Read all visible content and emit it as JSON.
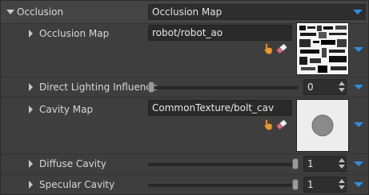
{
  "colors": {
    "accent": "#2f8fe0",
    "hand": "#e49a3a",
    "panel": "#3e3e3e"
  },
  "occlusion": {
    "label": "Occlusion",
    "mode_value": "Occlusion Map",
    "expand_icon": "triangle-down-icon"
  },
  "rows": {
    "occlusion_map": {
      "label": "Occlusion Map",
      "path": "robot/robot_ao",
      "pick_icon": "hand-pointer-icon",
      "clear_icon": "eraser-icon",
      "thumbnail": "robot-ao-texture-preview"
    },
    "direct_lighting": {
      "label": "Direct Lighting Influence",
      "value": "0",
      "slider_fraction": 0
    },
    "cavity_map": {
      "label": "Cavity Map",
      "path": "CommonTexture/bolt_cav",
      "pick_icon": "hand-pointer-icon",
      "clear_icon": "eraser-icon",
      "thumbnail": "bolt-cavity-preview"
    },
    "diffuse_cavity": {
      "label": "Diffuse Cavity",
      "value": "1",
      "slider_fraction": 1
    },
    "specular_cavity": {
      "label": "Specular Cavity",
      "value": "1",
      "slider_fraction": 1
    }
  }
}
